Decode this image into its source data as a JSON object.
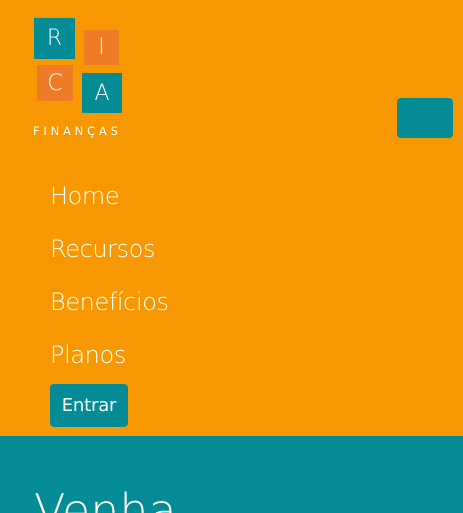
{
  "logo": {
    "letters": [
      "R",
      "I",
      "C",
      "A"
    ],
    "subtitle": "FINANÇAS"
  },
  "nav": {
    "items": [
      {
        "label": "Home"
      },
      {
        "label": "Recursos"
      },
      {
        "label": "Benefícios"
      },
      {
        "label": "Planos"
      }
    ],
    "login_label": "Entrar"
  },
  "hero": {
    "title": "Venha"
  },
  "colors": {
    "background": "#f89800",
    "teal": "#038b96",
    "tile_orange": "#ee7c27",
    "text": "#ffffff"
  }
}
